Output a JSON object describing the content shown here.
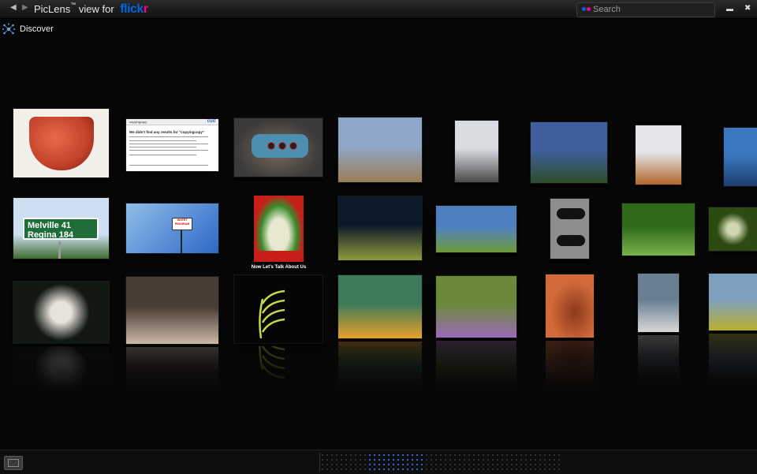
{
  "titlebar": {
    "back_label": "◀",
    "forward_label": "▶",
    "app_name": "PicLens",
    "trademark": "™",
    "view_for": "view for",
    "service": "flickr",
    "service_colors": {
      "flick": "#0063dc",
      "r": "#ff0084"
    },
    "search_placeholder": "Search",
    "minimize_label": "▬",
    "close_label": "✖"
  },
  "discover": {
    "label": "Discover",
    "icon": "discover-star-icon"
  },
  "wall": {
    "photos": [
      {
        "id": "red-glass-bowl",
        "colors": [
          "#f3f0ea",
          "#c2412a"
        ]
      },
      {
        "id": "search-results-page",
        "colors": [
          "#ffffff",
          "#ffffff"
        ]
      },
      {
        "id": "usb-device",
        "colors": [
          "#3a3a3a",
          "#4d8fb0"
        ]
      },
      {
        "id": "dry-plant-field",
        "colors": [
          "#8ea6c9",
          "#9a7d55"
        ]
      },
      {
        "id": "lion-statue",
        "colors": [
          "#d9dde2",
          "#4a4a4a"
        ]
      },
      {
        "id": "clouds-road",
        "colors": [
          "#3f5f9e",
          "#2e4d2a"
        ]
      },
      {
        "id": "autumn-tree",
        "colors": [
          "#e4e6ea",
          "#b1672a"
        ]
      },
      {
        "id": "car-trunk",
        "colors": [
          "#3c78c0",
          "#1d3f70"
        ]
      },
      {
        "id": "melville-road-sign",
        "colors": [
          "#cde0f2",
          "#3f6a2e"
        ]
      },
      {
        "id": "sign-blue-sky",
        "colors": [
          "#2e68c6",
          "#8fbde9"
        ]
      },
      {
        "id": "green-onions-poster",
        "colors": [
          "#c61f1a",
          "#e8e8d0"
        ]
      },
      {
        "id": "night-canal",
        "colors": [
          "#0d1a2a",
          "#8f9a3d"
        ]
      },
      {
        "id": "fence-field",
        "colors": [
          "#4f7fbf",
          "#6e9a3a"
        ]
      },
      {
        "id": "shoes-carpet",
        "colors": [
          "#8d8d8d",
          "#111111"
        ]
      },
      {
        "id": "grass-closeup",
        "colors": [
          "#2f6a1a",
          "#7ab34a"
        ]
      },
      {
        "id": "dandelion",
        "colors": [
          "#2d4a10",
          "#cfd7b0"
        ]
      },
      {
        "id": "white-flowers",
        "colors": [
          "#111811",
          "#e8e2dc"
        ]
      },
      {
        "id": "tree-stump",
        "colors": [
          "#4a3d33",
          "#cbb9a8"
        ]
      },
      {
        "id": "glow-stick",
        "colors": [
          "#050505",
          "#c9d64a"
        ]
      },
      {
        "id": "child-boat",
        "colors": [
          "#3d7a5a",
          "#e8a12a"
        ]
      },
      {
        "id": "flower-beds",
        "colors": [
          "#6a8a3a",
          "#9a6ab8"
        ]
      },
      {
        "id": "ear-closeup",
        "colors": [
          "#d46a3a",
          "#8a3a1a"
        ]
      },
      {
        "id": "desk-papers",
        "colors": [
          "#6a7f92",
          "#d8d8d8"
        ]
      },
      {
        "id": "park-yellow-flowers",
        "colors": [
          "#7fa0c0",
          "#b8b030"
        ]
      }
    ],
    "search_page": {
      "query_box": "copyingcopy",
      "heading": "We didn't find any results for \"copyingcopy\"",
      "logo": "cuil"
    },
    "road_sign": {
      "line1": "Melville 41",
      "line2": "Regina 184"
    },
    "small_sign": {
      "line1": "INVERT",
      "line2": "PROGRAM"
    },
    "poster": {
      "caption": "Now Let's Talk About Us"
    }
  },
  "bottombar": {
    "view_icon": "gallery-view-icon",
    "scrubber_active_color": "#3b63d8"
  }
}
